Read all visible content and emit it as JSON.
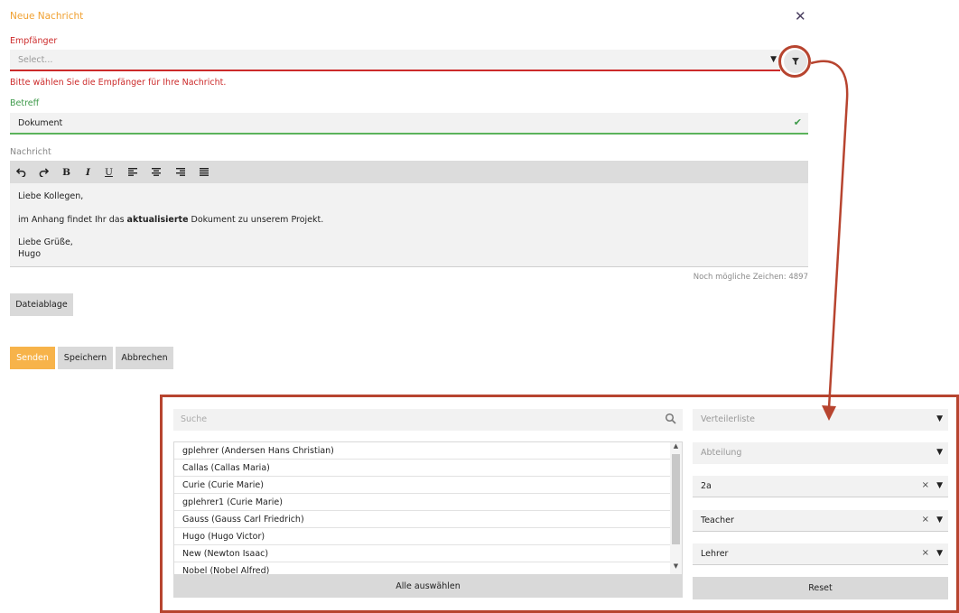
{
  "dialog": {
    "title": "Neue Nachricht",
    "close_icon": "close-icon"
  },
  "recipients": {
    "label": "Empfänger",
    "placeholder": "Select...",
    "error": "Bitte wählen Sie die Empfänger für Ihre Nachricht.",
    "filter_icon": "filter-icon"
  },
  "subject": {
    "label": "Betreff",
    "value": "Dokument"
  },
  "message": {
    "label": "Nachricht",
    "toolbar": [
      "undo-icon",
      "redo-icon",
      "bold-icon",
      "italic-icon",
      "underline-icon",
      "align-left-icon",
      "align-center-icon",
      "align-right-icon",
      "align-justify-icon"
    ],
    "line1": "Liebe Kollegen,",
    "line2_pre": "im Anhang findet Ihr das ",
    "line2_bold": "aktualisierte",
    "line2_post": " Dokument zu unserem Projekt.",
    "line3": "Liebe Grüße,",
    "line4": "Hugo",
    "counter": "Noch mögliche Zeichen: 4897"
  },
  "buttons": {
    "dateiablage": "Dateiablage",
    "senden": "Senden",
    "speichern": "Speichern",
    "abbrechen": "Abbrechen"
  },
  "filter_panel": {
    "search_placeholder": "Suche",
    "users": [
      "gplehrer (Andersen Hans Christian)",
      "Callas (Callas Maria)",
      "Curie (Curie Marie)",
      "gplehrer1 (Curie Marie)",
      "Gauss (Gauss Carl Friedrich)",
      "Hugo (Hugo Victor)",
      "New (Newton Isaac)",
      "Nobel (Nobel Alfred)"
    ],
    "select_all": "Alle auswählen",
    "distribution_list_placeholder": "Verteilerliste",
    "department_placeholder": "Abteilung",
    "class_value": "2a",
    "role_value": "Teacher",
    "group_value": "Lehrer",
    "reset": "Reset"
  },
  "colors": {
    "accent_orange": "#f7b34a",
    "error_red": "#cc2a2a",
    "success_green": "#3e9a4a",
    "annotation": "#b7442f"
  }
}
